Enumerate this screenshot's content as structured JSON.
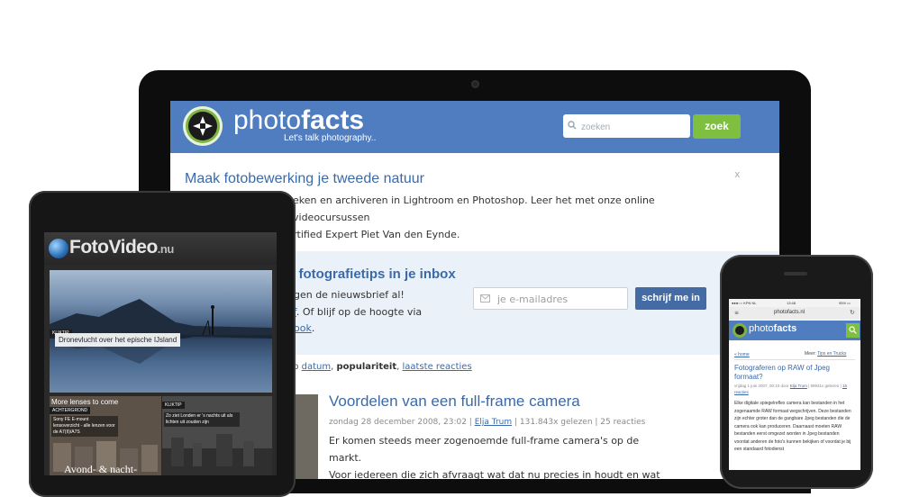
{
  "desktop": {
    "logo": {
      "word_light": "photo",
      "word_bold": "facts",
      "tagline": "Let's talk photography.."
    },
    "search": {
      "placeholder": "zoeken",
      "button": "zoek"
    },
    "promo": {
      "title": "Maak fotobewerking je tweede natuur",
      "close": "x",
      "line1": "eken en archiveren in Lightroom en Photoshop. Leer het met onze online videocursussen",
      "line2": "rtified Expert Piet Van den Eynde."
    },
    "newsletter": {
      "title": "s fotografietips in je inbox",
      "line1": "ngen de nieuwsbrief al!",
      "line2_link": "ef",
      "line2_rest": ". Of blijf op de hoogte via",
      "line3_link": "book",
      "line3_rest": ".",
      "email_placeholder": "je e-mailadres",
      "button": "schrijf me in"
    },
    "sort": {
      "prefix": "op",
      "link1": "datum",
      "sep1": ",",
      "active": "populariteit",
      "sep2": ",",
      "link2": "laatste reacties"
    },
    "article": {
      "title": "Voordelen van een full-frame camera",
      "date": "zondag 28 december 2008, 23:02 |",
      "author": "Elja Trum",
      "stats": "| 131.843x gelezen | 25 reacties",
      "line1": "Er komen steeds meer zogenoemde full-frame camera's op de markt.",
      "line2": "Voor iedereen die zich afvraagt wat dat nu precies in houdt en wat de"
    }
  },
  "tablet": {
    "logo_main": "FotoVideo",
    "logo_suffix": ".nu",
    "hero": {
      "tag": "KLIKTIP",
      "caption": "Dronevlucht over het epische IJsland"
    },
    "card_left": {
      "title": "More lenses to come",
      "tag": "ACHTERGROND",
      "text": "Sony FE E-mount lensoverzicht - alle lenzen voor de A7(II)/A7S"
    },
    "card_right": {
      "tag": "KLIKTIP",
      "text": "Zo ziet Londen er 's nachts uit als lichten uit zouden zijn"
    },
    "bottom_title": "Avond- & nacht-"
  },
  "phone": {
    "status_carrier": "●●●○○ KPN NL",
    "status_time": "13:48",
    "status_battery": "95% ▭",
    "url": "photofacts.nl",
    "menu_icon": "≡",
    "reload_icon": "↻",
    "logo_light": "photo",
    "logo_bold": "facts",
    "home": "« home",
    "meer_label": "Meer:",
    "meer_link": "Tips en Trucks",
    "title": "Fotograferen op RAW of Jpeg formaat?",
    "meta_text": "vrijdag 1 juni 2007, 00:10 door",
    "meta_author": "Elja Trum",
    "meta_rest": "| 99931x gelezen |",
    "meta_reactions": "15 reacties",
    "body": "Elke digitale spiegelreflex camera kan bestanden in het zogenaamde RAW formaat wegschrijven. Deze bestanden zijn echter groter dan de gangbare Jpeg bestanden die de camera ook kan produceren. Daarnaast moeten RAW bestanden eerst omgezet worden in Jpeg bestanden voordat anderen de foto's kunnen bekijken of voordat je bij een standaard fotodienst"
  },
  "colors": {
    "brand_blue": "#4f7dbf",
    "brand_green": "#7fbf3f",
    "link_blue": "#3b6aa8",
    "button_blue": "#456ba5"
  }
}
